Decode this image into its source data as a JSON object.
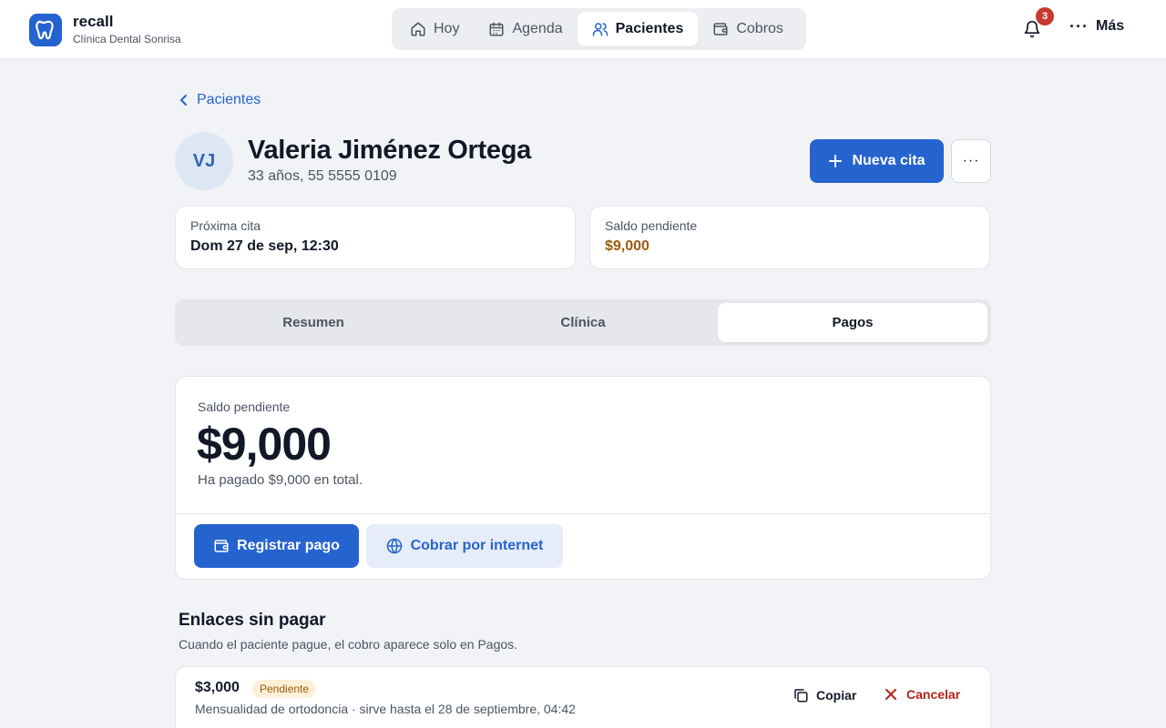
{
  "brand": {
    "name": "recall",
    "clinic": "Clínica Dental Sonrisa",
    "icon": "tooth-icon"
  },
  "nav": {
    "items": [
      {
        "label": "Hoy",
        "icon": "home-icon",
        "active": false
      },
      {
        "label": "Agenda",
        "icon": "calendar-icon",
        "active": false
      },
      {
        "label": "Pacientes",
        "icon": "users-icon",
        "active": true
      },
      {
        "label": "Cobros",
        "icon": "wallet-icon",
        "active": false
      }
    ],
    "notifications_count": "3",
    "more_label": "Más"
  },
  "breadcrumb": {
    "back_label": "Pacientes"
  },
  "patient": {
    "initials": "VJ",
    "name": "Valeria Jiménez Ortega",
    "meta": "33 años, 55 5555 0109",
    "new_appointment_label": "Nueva cita"
  },
  "summary": {
    "next_appointment_label": "Próxima cita",
    "next_appointment_value": "Dom 27 de sep, 12:30",
    "balance_label": "Saldo pendiente",
    "balance_value": "$9,000"
  },
  "tabs": [
    {
      "label": "Resumen",
      "active": false
    },
    {
      "label": "Clínica",
      "active": false
    },
    {
      "label": "Pagos",
      "active": true
    }
  ],
  "payments": {
    "balance_label": "Saldo pendiente",
    "balance_amount": "$9,000",
    "paid_note": "Ha pagado $9,000 en total.",
    "register_label": "Registrar pago",
    "online_label": "Cobrar por internet"
  },
  "unpaid_links": {
    "title": "Enlaces sin pagar",
    "subtitle": "Cuando el paciente pague, el cobro aparece solo en Pagos.",
    "items": [
      {
        "amount": "$3,000",
        "status": "Pendiente",
        "description": "Mensualidad de ortodoncia · sirve hasta el 28 de septiembre, 04:42",
        "copy_label": "Copiar",
        "cancel_label": "Cancelar"
      }
    ]
  },
  "colors": {
    "accent": "#2563cf",
    "amber": "#9a5b0c",
    "danger": "#b42318",
    "badge": "#c73a2f",
    "background": "#f1f3f6"
  }
}
